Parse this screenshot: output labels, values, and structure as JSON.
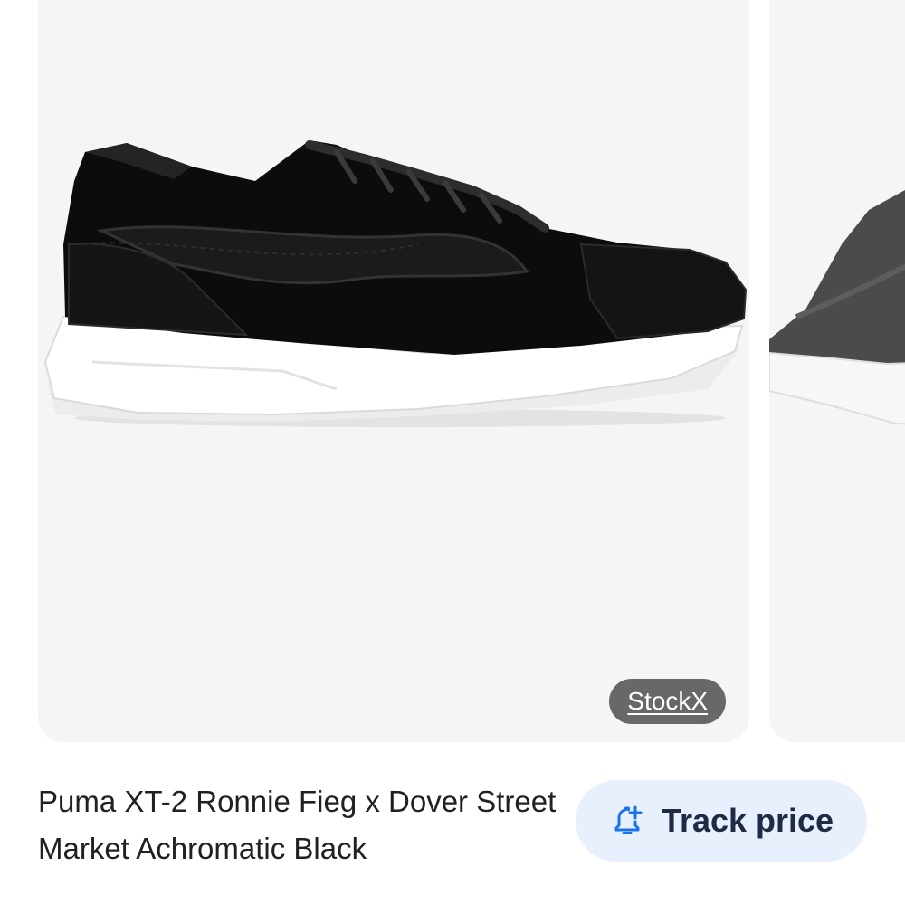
{
  "product": {
    "title": "Puma XT-2 Ronnie Fieg x Dover Street Market Achromatic Black",
    "image_alt": "Black leather Puma sneaker with white sole"
  },
  "source_chip": {
    "label": "StockX"
  },
  "actions": {
    "track_price_label": "Track price",
    "track_icon": "bell-plus-icon"
  },
  "colors": {
    "card_background": "#f5f5f6",
    "chip_background": "#5f6062",
    "button_background": "#e8f0fe",
    "icon_blue": "#1a73e8"
  }
}
